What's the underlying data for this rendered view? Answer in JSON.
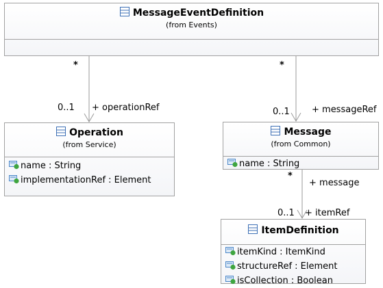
{
  "classes": {
    "message_event_definition": {
      "name": "MessageEventDefinition",
      "from": "(from Events)"
    },
    "operation": {
      "name": "Operation",
      "from": "(from Service)",
      "attributes": [
        "name : String",
        "implementationRef : Element"
      ]
    },
    "message": {
      "name": "Message",
      "from": "(from Common)",
      "attributes": [
        "name : String"
      ]
    },
    "item_definition": {
      "name": "ItemDefinition",
      "attributes": [
        "itemKind : ItemKind",
        "structureRef : Element",
        "isCollection : Boolean"
      ]
    }
  },
  "associations": {
    "med_to_operation": {
      "source_mult": "*",
      "target_mult": "0..1",
      "role": "+ operationRef"
    },
    "med_to_message": {
      "source_mult": "*",
      "target_mult": "0..1",
      "role": "+ messageRef"
    },
    "message_to_item": {
      "source_mult": "*",
      "source_role": "+ message",
      "target_mult": "0..1",
      "role": "+ itemRef"
    }
  },
  "colors": {
    "border": "#a0a0a0",
    "edge": "#9a9a9a",
    "class_icon": "#3c6fb5",
    "attr_icon_blue": "#4a86c8",
    "attr_icon_green": "#3fa53f"
  },
  "icons": {
    "class": "class-icon",
    "attribute": "attribute-icon"
  }
}
